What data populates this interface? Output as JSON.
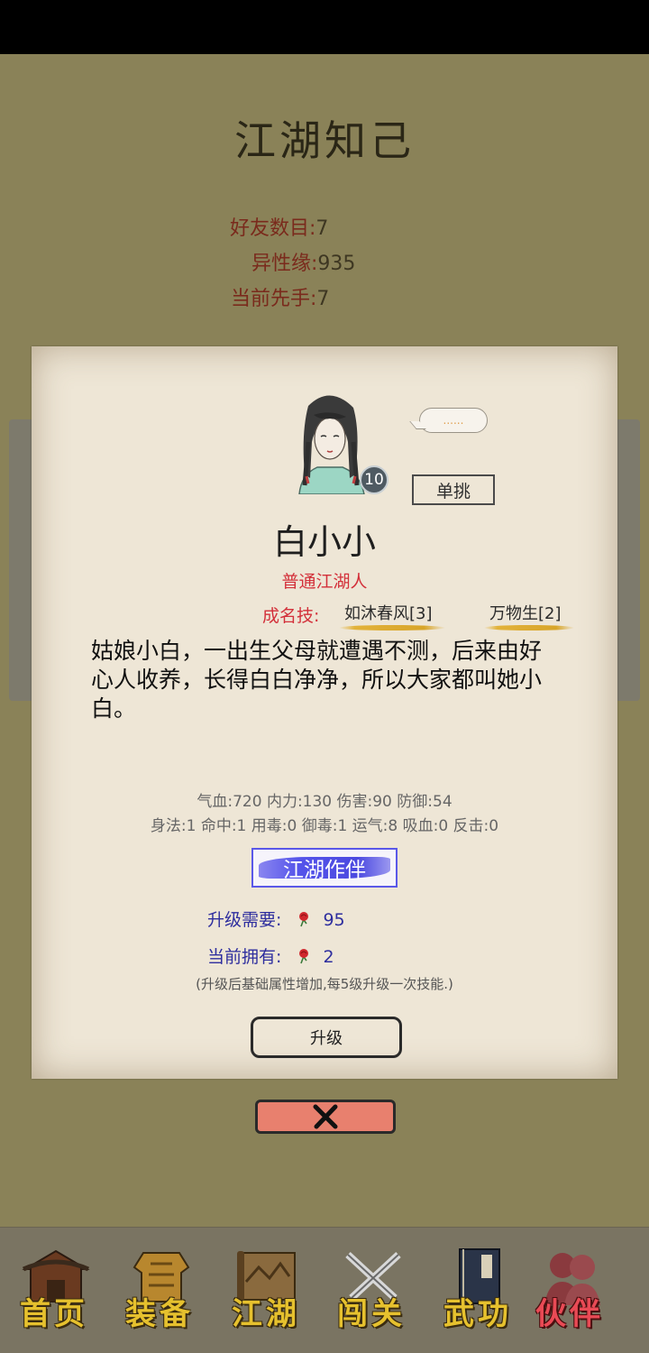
{
  "header": {
    "title": "江湖知己"
  },
  "stats": {
    "friends_label": "好友数目:",
    "friends_value": "7",
    "affinity_label": "异性缘:",
    "affinity_value": "935",
    "initiative_label": "当前先手:",
    "initiative_value": "7"
  },
  "card": {
    "speech_text": "......",
    "level": "10",
    "duel_label": "单挑",
    "name": "白小小",
    "title": "普通江湖人",
    "skills_label": "成名技:",
    "skills": [
      "如沐春风[3]",
      "万物生[2]"
    ],
    "description": "姑娘小白，一出生父母就遭遇不测，后来由好心人收养，长得白白净净，所以大家都叫她小白。",
    "attributes_line1": "气血:720  内力:130  伤害:90  防御:54",
    "attributes_line2": "身法:1  命中:1  用毒:0  御毒:1  运气:8  吸血:0  反击:0",
    "partner_label": "江湖作伴",
    "upgrade_need_label": "升级需要:",
    "upgrade_need_value": "95",
    "owned_label": "当前拥有:",
    "owned_value": "2",
    "note": "(升级后基础属性增加,每5级升级一次技能.)",
    "upgrade_label": "升级"
  },
  "nav": [
    {
      "label": "首页",
      "icon": "house-icon"
    },
    {
      "label": "装备",
      "icon": "armor-icon"
    },
    {
      "label": "江湖",
      "icon": "scroll-map-icon"
    },
    {
      "label": "闯关",
      "icon": "swords-icon"
    },
    {
      "label": "武功",
      "icon": "book-icon"
    },
    {
      "label": "伙伴",
      "icon": "partners-icon",
      "active": true
    }
  ],
  "colors": {
    "accent_red": "#d3303a",
    "partner_blue": "#5554ea",
    "close_red": "#e8806e",
    "nav_gold": "#e6c12e"
  }
}
